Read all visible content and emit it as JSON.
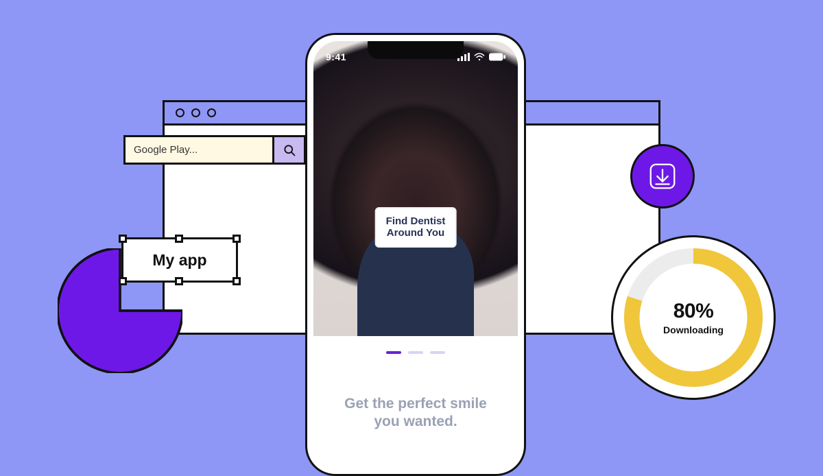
{
  "colors": {
    "background": "#8e97f5",
    "accent_purple": "#6e18e8",
    "accent_gold": "#f0c63b"
  },
  "browser": {
    "traffic_dots": 3
  },
  "search": {
    "placeholder": "Google Play..."
  },
  "pie": {
    "cut_angle_deg": 90
  },
  "card": {
    "label": "My app"
  },
  "phone": {
    "status": {
      "time": "9:41"
    },
    "cta_line1": "Find Dentist",
    "cta_line2": "Around You",
    "indicator_count": 3,
    "active_index": 0,
    "tagline_line1": "Get the perfect smile",
    "tagline_line2": "you wanted."
  },
  "download": {
    "percent_text": "80%",
    "label": "Downloading"
  },
  "chart_data": {
    "type": "pie",
    "title": "",
    "values": [
      75,
      25
    ],
    "categories": [
      "filled",
      "cut"
    ]
  }
}
